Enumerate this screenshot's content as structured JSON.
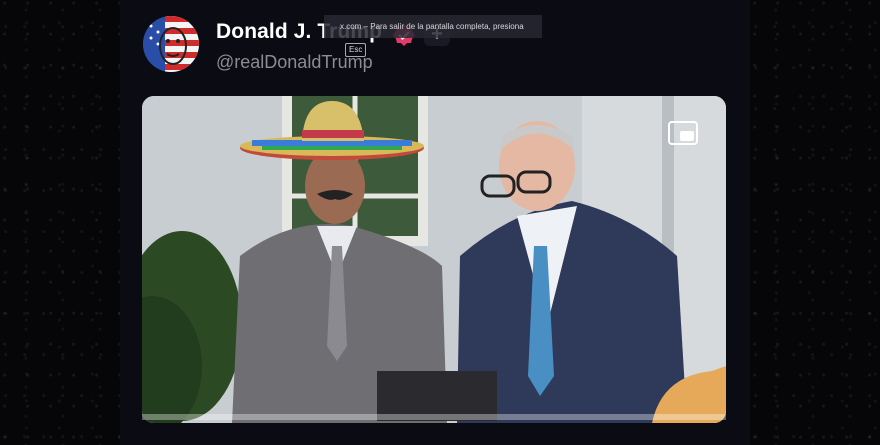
{
  "post": {
    "display_name": "Donald J. Trump",
    "handle": "@realDonaldTrump",
    "avatar_icon": "flag-face-avatar",
    "verified_icon": "verified-badge-icon",
    "verified_color": "#e33a6b",
    "follow_label": "+"
  },
  "fullscreen_toast": {
    "text": "x.com – Para salir de la pantalla completa, presiona",
    "key": "Esc"
  },
  "video": {
    "pip_icon": "picture-in-picture-icon",
    "scene": "white-house-press-gaggle"
  },
  "colors": {
    "page_bg": "#050507",
    "panel_bg": "#0b0b14",
    "name_text": "#ffffff",
    "handle_text": "#8a8d96"
  }
}
